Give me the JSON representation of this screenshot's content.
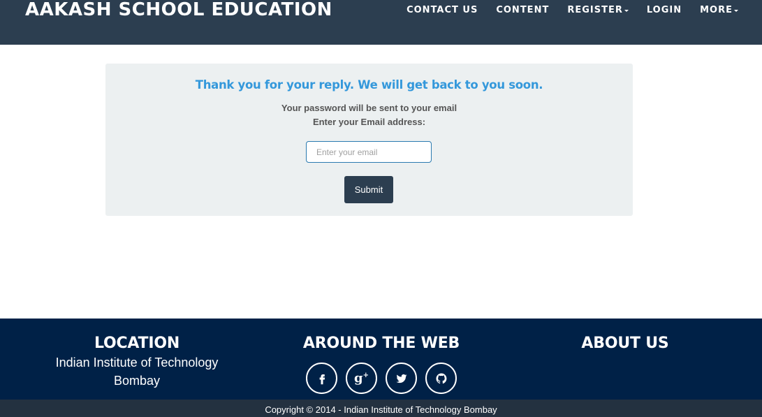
{
  "navbar": {
    "brand": "AAKASH SCHOOL EDUCATION",
    "items": [
      {
        "label": "CONTACT US",
        "dropdown": false
      },
      {
        "label": "CONTENT",
        "dropdown": false
      },
      {
        "label": "REGISTER",
        "dropdown": true
      },
      {
        "label": "LOGIN",
        "dropdown": false
      },
      {
        "label": "MORE",
        "dropdown": true
      }
    ]
  },
  "panel": {
    "heading": "Thank you for your reply. We will get back to you soon.",
    "line1": "Your password will be sent to your email",
    "line2": "Enter your Email address:",
    "email_value": "",
    "email_placeholder": "Enter your email",
    "submit_label": "Submit"
  },
  "footer": {
    "location_title": "LOCATION",
    "location_line1": "Indian Institute of Technology",
    "location_line2": "Bombay",
    "web_title": "AROUND THE WEB",
    "socials": [
      "facebook-icon",
      "google-plus-icon",
      "twitter-icon",
      "github-icon"
    ],
    "about_title": "ABOUT US",
    "copyright": "Copyright © 2014 - Indian Institute of Technology Bombay"
  },
  "colors": {
    "navbar": "#2c3e50",
    "accent": "#3498db",
    "panel": "#ecf0f1",
    "footer": "#002147",
    "footer_bottom": "#233140"
  }
}
